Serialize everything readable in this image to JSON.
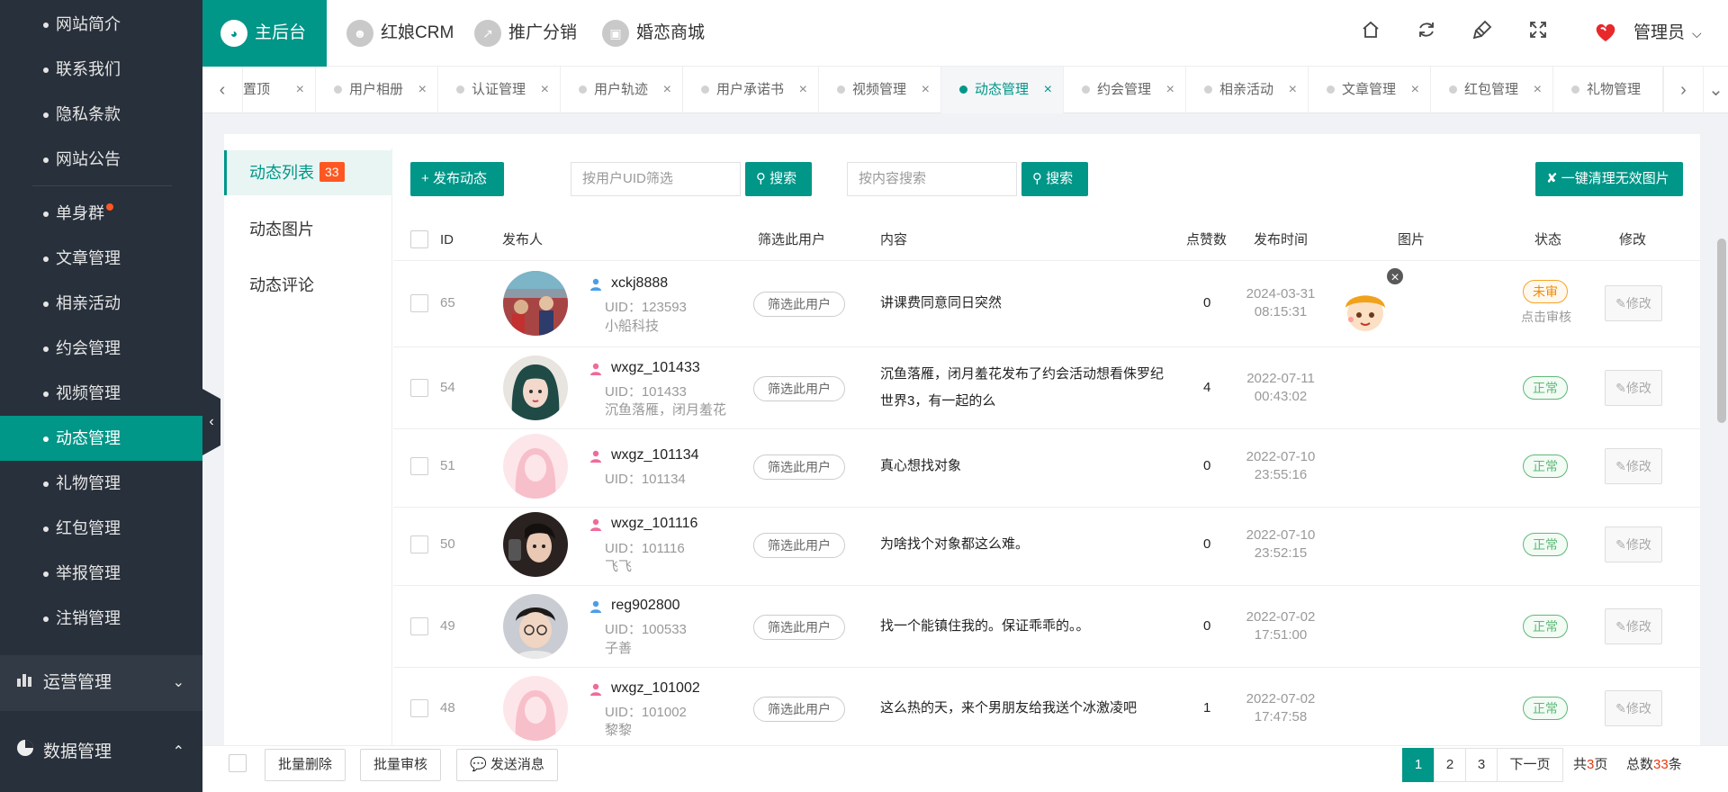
{
  "sidebar": {
    "items": [
      {
        "label": "网站简介"
      },
      {
        "label": "联系我们"
      },
      {
        "label": "隐私条款"
      },
      {
        "label": "网站公告"
      },
      {
        "label": "单身群"
      },
      {
        "label": "文章管理"
      },
      {
        "label": "相亲活动"
      },
      {
        "label": "约会管理"
      },
      {
        "label": "视频管理"
      },
      {
        "label": "动态管理"
      },
      {
        "label": "礼物管理"
      },
      {
        "label": "红包管理"
      },
      {
        "label": "举报管理"
      },
      {
        "label": "注销管理"
      }
    ],
    "active_index": 9,
    "groups": [
      {
        "label": "运营管理",
        "icon": "bar-chart-icon"
      },
      {
        "label": "数据管理",
        "icon": "pie-chart-icon"
      }
    ]
  },
  "topbar": {
    "tabs": [
      {
        "label": "主后台",
        "icon": "dashboard-icon"
      },
      {
        "label": "红娘CRM",
        "icon": "crm-icon"
      },
      {
        "label": "推广分销",
        "icon": "promotion-icon"
      },
      {
        "label": "婚恋商城",
        "icon": "shop-icon"
      }
    ],
    "admin": "管理员"
  },
  "page_tabs": [
    {
      "label": "置顶"
    },
    {
      "label": "用户相册"
    },
    {
      "label": "认证管理"
    },
    {
      "label": "用户轨迹"
    },
    {
      "label": "用户承诺书"
    },
    {
      "label": "视频管理"
    },
    {
      "label": "动态管理"
    },
    {
      "label": "约会管理"
    },
    {
      "label": "相亲活动"
    },
    {
      "label": "文章管理"
    },
    {
      "label": "红包管理"
    },
    {
      "label": "礼物管理"
    }
  ],
  "subnav": {
    "items": [
      {
        "label": "动态列表",
        "badge": "33"
      },
      {
        "label": "动态图片"
      },
      {
        "label": "动态评论"
      }
    ]
  },
  "toolbar": {
    "publish": "发布动态",
    "uid_placeholder": "按用户UID筛选",
    "search1": "搜索",
    "content_placeholder": "按内容搜索",
    "search2": "搜索",
    "clean": "一键清理无效图片"
  },
  "table": {
    "headers": {
      "id": "ID",
      "publisher": "发布人",
      "filter": "筛选此用户",
      "content": "内容",
      "likes": "点赞数",
      "time": "发布时间",
      "image": "图片",
      "status": "状态",
      "edit": "修改"
    },
    "filter_label": "筛选此用户",
    "edit_label": "修改",
    "rows": [
      {
        "id": "65",
        "name": "xckj8888",
        "uid": "UID：123593",
        "nick": "小船科技",
        "content": "讲课费同意同日突然",
        "likes": "0",
        "date": "2024-03-31",
        "clock": "08:15:31",
        "status": "未审",
        "status_sub": "点击审核"
      },
      {
        "id": "54",
        "name": "wxgz_101433",
        "uid": "UID：101433",
        "nick": "沉鱼落雁，闭月羞花",
        "content": "沉鱼落雁，闭月羞花发布了约会活动想看侏罗纪世界3，有一起的么",
        "likes": "4",
        "date": "2022-07-11",
        "clock": "00:43:02",
        "status": "正常"
      },
      {
        "id": "51",
        "name": "wxgz_101134",
        "uid": "UID：101134",
        "nick": "",
        "content": "真心想找对象",
        "likes": "0",
        "date": "2022-07-10",
        "clock": "23:55:16",
        "status": "正常"
      },
      {
        "id": "50",
        "name": "wxgz_101116",
        "uid": "UID：101116",
        "nick": "飞飞",
        "content": "为啥找个对象都这么难。",
        "likes": "0",
        "date": "2022-07-10",
        "clock": "23:52:15",
        "status": "正常"
      },
      {
        "id": "49",
        "name": "reg902800",
        "uid": "UID：100533",
        "nick": "子善",
        "content": "找一个能镇住我的。保证乖乖的。。",
        "likes": "0",
        "date": "2022-07-02",
        "clock": "17:51:00",
        "status": "正常"
      },
      {
        "id": "48",
        "name": "wxgz_101002",
        "uid": "UID：101002",
        "nick": "黎黎",
        "content": "这么热的天，来个男朋友给我送个冰激凌吧",
        "likes": "1",
        "date": "2022-07-02",
        "clock": "17:47:58",
        "status": "正常"
      }
    ]
  },
  "footer": {
    "batch_delete": "批量删除",
    "batch_review": "批量审核",
    "send_message": "发送消息",
    "pages": [
      "1",
      "2",
      "3"
    ],
    "next": "下一页",
    "total_prefix": "共",
    "total_pages": "3",
    "total_pages_suffix": "页",
    "count_prefix": "总数",
    "count": "33",
    "count_suffix": "条"
  },
  "colors": {
    "accent": "#009688",
    "sidebar": "#28303b",
    "badge": "#ff5722",
    "ok": "#5fb878",
    "pending": "#f7a425"
  }
}
